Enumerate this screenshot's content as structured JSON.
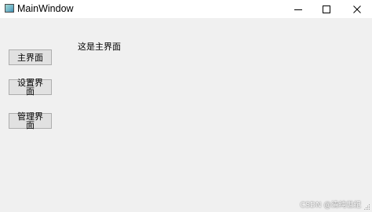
{
  "window": {
    "title": "MainWindow",
    "controls": {
      "minimize_icon": "minimize-icon",
      "maximize_icon": "maximize-icon",
      "close_icon": "close-icon"
    }
  },
  "sidebar": {
    "buttons": [
      {
        "label": "主界面"
      },
      {
        "label": "设置界面"
      },
      {
        "label": "管理界面"
      }
    ]
  },
  "content": {
    "current_page_text": "这是主界面"
  },
  "watermark": {
    "text": "CSDN @清纯世纪"
  },
  "colors": {
    "client_background": "#f0f0f0",
    "titlebar_background": "#ffffff",
    "button_background": "#e1e1e1",
    "button_border": "#adadad"
  }
}
